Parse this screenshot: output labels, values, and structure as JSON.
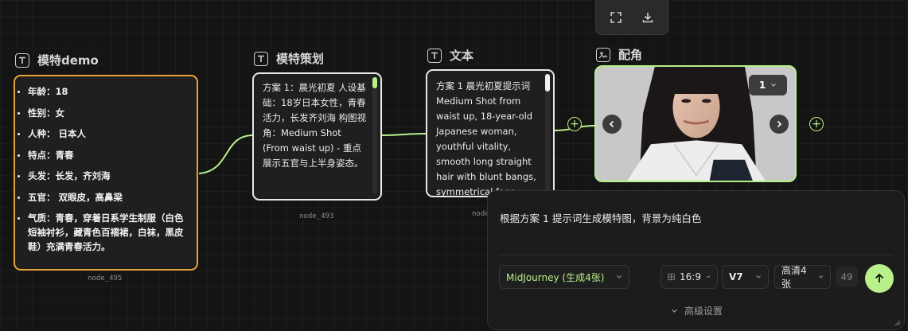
{
  "toolbar": {
    "fullscreen_icon": "fullscreen-icon",
    "download_icon": "download-icon"
  },
  "nodes": {
    "model": {
      "title": "模特demo",
      "id": "node_495",
      "items": [
        "年龄：18",
        "性别：女",
        "人种： 日本人",
        "特点：青春",
        "头发：长发，齐刘海",
        "五官： 双眼皮，高鼻梁",
        "气质：青春，穿着日系学生制服（白色短袖衬衫，藏青色百褶裙，白袜，黑皮鞋）充满青春活力。"
      ]
    },
    "plan": {
      "title": "模特策划",
      "id": "node_493",
      "text": "方案 1：晨光初夏 人设基础：18岁日本女性，青春活力，长发齐刘海 构图视角：Medium Shot (From waist up) - 重点展示五官与上半身姿态。"
    },
    "text": {
      "title": "文本",
      "id": "node",
      "text": "方案 1 晨光初夏提示词 Medium Shot from waist up, 18-year-old Japanese woman, youthful vitality, smooth long straight hair with blunt bangs, symmetrical face"
    },
    "image": {
      "title": "配角",
      "page": "1"
    }
  },
  "prompt_panel": {
    "prompt": "根据方案 1 提示词生成模特图，背景为纯白色",
    "model_select": "MidJourney (生成4张)",
    "ratio": "16:9",
    "version": "V7",
    "quality": "高清4张",
    "count": "49",
    "advanced": "高级设置"
  },
  "colors": {
    "accent_green": "#b8f08a",
    "model_border": "#e8a13a",
    "background": "#141414"
  }
}
